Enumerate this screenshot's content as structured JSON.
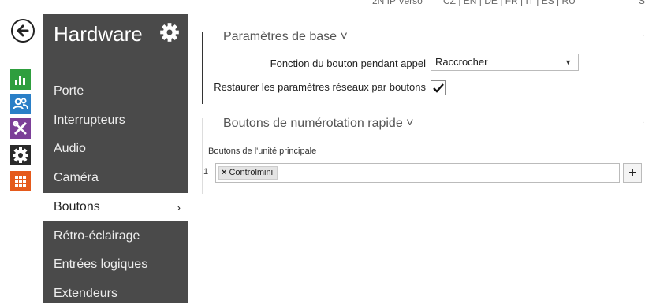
{
  "topbar": {
    "device": "2N IP Verso",
    "languages": "CZ | EN | DE | FR | IT | ES | RU",
    "logout": "Sorti"
  },
  "rail": {
    "back_icon": "arrow-left-icon",
    "items": [
      {
        "icon": "bar-chart-icon",
        "color": "#2e9e3e"
      },
      {
        "icon": "users-icon",
        "color": "#2a7fc7"
      },
      {
        "icon": "tools-icon",
        "color": "#7c3f98"
      },
      {
        "icon": "gear-icon",
        "color": "#2b2b2b"
      },
      {
        "icon": "grid-icon",
        "color": "#e55a1c"
      }
    ]
  },
  "sidebar": {
    "title": "Hardware",
    "title_icon": "gear-icon",
    "items": [
      {
        "label": "Porte"
      },
      {
        "label": "Interrupteurs"
      },
      {
        "label": "Audio"
      },
      {
        "label": "Caméra"
      },
      {
        "label": "Boutons",
        "active": true,
        "chevron": "›"
      },
      {
        "label": "Rétro-éclairage"
      },
      {
        "label": "Entrées logiques"
      },
      {
        "label": "Extendeurs"
      }
    ]
  },
  "base": {
    "title": "Paramètres de base ˅",
    "function_label": "Fonction du bouton pendant appel",
    "function_value": "Raccrocher",
    "restore_label": "Restaurer les paramètres réseaux par boutons",
    "restore_checked": true
  },
  "rapid": {
    "title": "Boutons de numérotation rapide ˅",
    "unit_label": "Boutons de l'unité principale",
    "row_number": "1",
    "token": "Controlmini",
    "add_label": "+"
  }
}
